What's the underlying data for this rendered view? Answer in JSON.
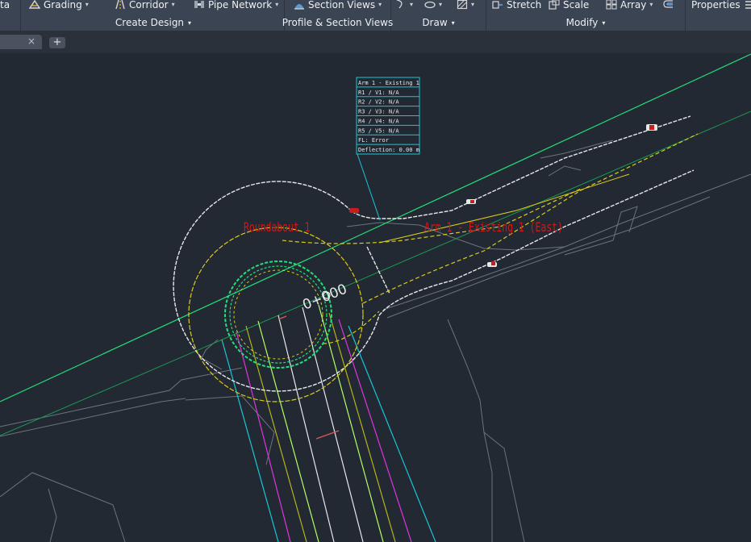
{
  "ribbon": {
    "row1": [
      {
        "id": "partial",
        "label": "ta",
        "caret": "▾"
      },
      {
        "id": "grading",
        "label": "Grading",
        "caret": "▾",
        "icon": "grading-icon"
      },
      {
        "id": "corridor",
        "label": "Corridor",
        "caret": "▾",
        "icon": "corridor-icon"
      },
      {
        "id": "pipe",
        "label": "Pipe Network",
        "caret": "▾",
        "icon": "pipe-network-icon"
      },
      {
        "id": "section",
        "label": "Section Views",
        "caret": "▾",
        "icon": "section-views-icon"
      },
      {
        "id": "stretch",
        "label": "Stretch",
        "icon": "stretch-icon"
      },
      {
        "id": "scale",
        "label": "Scale",
        "icon": "scale-icon"
      },
      {
        "id": "array",
        "label": "Array",
        "caret": "▾",
        "icon": "array-icon"
      },
      {
        "id": "properties",
        "label": "Properties",
        "icon": "properties-icon"
      }
    ],
    "panels": {
      "create_design": "Create Design",
      "profile_section": "Profile & Section Views",
      "draw": "Draw",
      "modify": "Modify",
      "caret": "▾"
    }
  },
  "tabs": {
    "close_glyph": "×",
    "new_tab_glyph": "+"
  },
  "drawing": {
    "label_table": {
      "rows": [
        "Arm 1 - Existing 1",
        "R1 / V1: N/A",
        "R2 / V2: N/A",
        "R3 / V3: N/A",
        "R4 / V4: N/A",
        "R5 / V5: N/A",
        "FL: Error",
        "Deflection: 0.00 m"
      ]
    },
    "roundabout_label": "Roundabout 1",
    "arm_label": "Arm 1 - Existing 1 (East)",
    "station_label": "0+000"
  },
  "colors": {
    "canvas": "#222933",
    "ribbon": "#3b4453",
    "white_linework": "#e8e8e8",
    "yellow_linework": "#d9cc1a",
    "green_linework": "#22e07a",
    "cyan_label": "#18c7d6",
    "red_text": "#d01818",
    "gray_linework": "#6d737b"
  }
}
